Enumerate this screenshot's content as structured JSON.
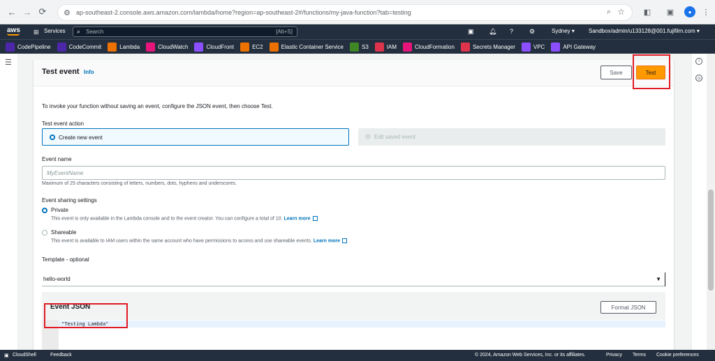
{
  "browser": {
    "url": "ap-southeast-2.console.aws.amazon.com/lambda/home?region=ap-southeast-2#/functions/my-java-function?tab=testing"
  },
  "aws_nav": {
    "logo": "aws",
    "services": "Services",
    "search_placeholder": "Search",
    "search_shortcut": "[Alt+S]",
    "region": "Sydney ▾",
    "account": "Sandbox/admin/u133128@001.fujifilm.com ▾"
  },
  "favorites": [
    {
      "label": "CodePipeline",
      "color": "#4d27aa"
    },
    {
      "label": "CodeCommit",
      "color": "#4d27aa"
    },
    {
      "label": "Lambda",
      "color": "#ed7100"
    },
    {
      "label": "CloudWatch",
      "color": "#e7157b"
    },
    {
      "label": "CloudFront",
      "color": "#8c4fff"
    },
    {
      "label": "EC2",
      "color": "#ed7100"
    },
    {
      "label": "Elastic Container Service",
      "color": "#ed7100"
    },
    {
      "label": "S3",
      "color": "#3f8624"
    },
    {
      "label": "IAM",
      "color": "#dd344c"
    },
    {
      "label": "CloudFormation",
      "color": "#e7157b"
    },
    {
      "label": "Secrets Manager",
      "color": "#dd344c"
    },
    {
      "label": "VPC",
      "color": "#8c4fff"
    },
    {
      "label": "API Gateway",
      "color": "#8c4fff"
    }
  ],
  "panel": {
    "title": "Test event",
    "info": "Info",
    "save_label": "Save",
    "test_label": "Test",
    "intro": "To invoke your function without saving an event, configure the JSON event, then choose Test.",
    "event_action_label": "Test event action",
    "create_new": "Create new event",
    "edit_saved": "Edit saved event",
    "event_name_label": "Event name",
    "event_name_placeholder": "MyEventName",
    "event_name_hint": "Maximum of 25 characters consisting of letters, numbers, dots, hyphens and underscores.",
    "sharing_label": "Event sharing settings",
    "private_label": "Private",
    "private_desc": "This event is only available in the Lambda console and to the event creator. You can configure a total of 10.",
    "shareable_label": "Shareable",
    "shareable_desc": "This event is available to IAM users within the same account who have permissions to access and use shareable events.",
    "learn_more": "Learn more",
    "template_label": "Template - optional",
    "template_value": "hello-world",
    "json_title": "Event JSON",
    "format_json": "Format JSON",
    "json_code": "\"Testing Lambda\""
  },
  "footer": {
    "cloudshell": "CloudShell",
    "feedback": "Feedback",
    "copyright": "© 2024, Amazon Web Services, Inc. or its affiliates.",
    "privacy": "Privacy",
    "terms": "Terms",
    "cookies": "Cookie preferences"
  }
}
